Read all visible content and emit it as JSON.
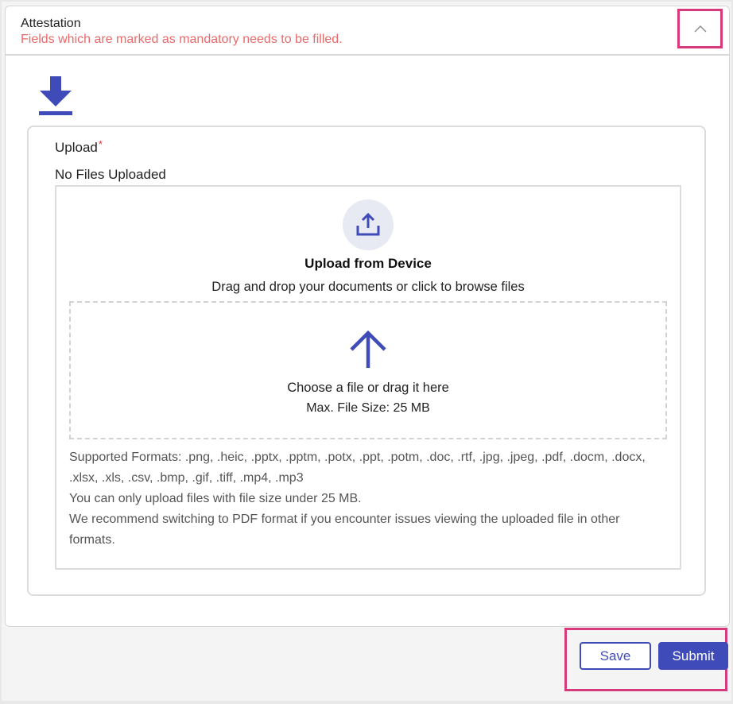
{
  "section": {
    "title": "Attestation",
    "subtitle": "Fields which are marked as mandatory needs to be filled.",
    "collapse_icon": "chevron-up-icon",
    "download_icon": "download-icon"
  },
  "upload": {
    "label": "Upload",
    "required_marker": "*",
    "status": "No Files Uploaded",
    "device_icon": "upload-tray-icon",
    "device_title": "Upload from Device",
    "device_description": "Drag and drop your documents or click to browse files",
    "dropzone_icon": "arrow-up-icon",
    "dropzone_text": "Choose a file or drag it here",
    "max_size": "Max. File Size: 25 MB",
    "supported_formats": "Supported Formats: .png, .heic, .pptx, .pptm, .potx, .ppt, .potm, .doc, .rtf, .jpg, .jpeg, .pdf, .docm, .docx, .xlsx, .xls, .csv, .bmp, .gif, .tiff, .mp4, .mp3",
    "size_note": "You can only upload files with file size under 25 MB.",
    "pdf_note": "We recommend switching to PDF format if you encounter issues viewing the uploaded file in other formats."
  },
  "actions": {
    "save_label": "Save",
    "submit_label": "Submit"
  },
  "colors": {
    "accent": "#3e4bb8",
    "error_text": "#ea6a6a",
    "highlight": "#d63a7a"
  }
}
